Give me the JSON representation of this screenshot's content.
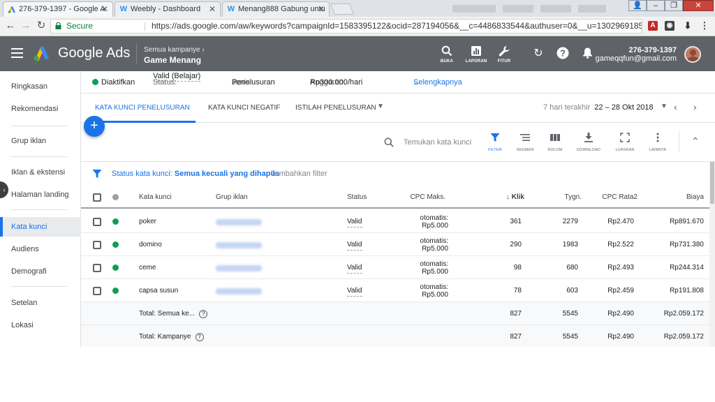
{
  "browser": {
    "tabs": [
      {
        "title": "276-379-1397 - Google A",
        "icon": "google-ads-favicon"
      },
      {
        "title": "Weebly - Dashboard",
        "icon": "weebly-favicon"
      },
      {
        "title": "Menang888 Gabung untu",
        "icon": "weebly-favicon"
      }
    ],
    "secure_label": "Secure",
    "url": "https://ads.google.com/aw/keywords?campaignId=1583395122&ocid=287194056&__c=4486833544&authuser=0&__u=1302969185"
  },
  "header": {
    "brand": "Google Ads",
    "crumb_parent": "Semua kampanye",
    "crumb_current": "Game Menang",
    "icons": [
      {
        "name": "search",
        "label": "BUKA"
      },
      {
        "name": "reports",
        "label": "LAPORAN"
      },
      {
        "name": "tools",
        "label": "FITUR"
      }
    ],
    "account_id": "276-379-1397",
    "account_email": "gameqqfun@gmail.com"
  },
  "sidenav": {
    "items": [
      {
        "label": "Ringkasan"
      },
      {
        "label": "Rekomendasi"
      },
      {
        "label": "Grup iklan"
      },
      {
        "label": "Iklan & ekstensi"
      },
      {
        "label": "Halaman landing"
      },
      {
        "label": "Kata kunci"
      },
      {
        "label": "Audiens"
      },
      {
        "label": "Demografi"
      },
      {
        "label": "Setelan"
      },
      {
        "label": "Lokasi"
      }
    ],
    "active": "Kata kunci"
  },
  "status": {
    "enabled": "Diaktifkan",
    "status_label": "Status:",
    "status_value": "Valid (Belajar)",
    "type_label": "Jenis:",
    "type_value": "Penelusuran",
    "budget_label": "Anggaran:",
    "budget_value": "Rp300.000/hari",
    "more": "Selengkapnya"
  },
  "tabs": {
    "items": [
      "KATA KUNCI PENELUSURAN",
      "KATA KUNCI NEGATIF",
      "ISTILAH PENELUSURAN"
    ],
    "date_label": "7 hari terakhir",
    "date_value": "22 – 28 Okt 2018"
  },
  "toolbar": {
    "search_placeholder": "Temukan kata kunci",
    "buttons": [
      "FILTER",
      "SEGMEN",
      "KOLOM",
      "DOWNLOAD",
      "LUASKAN",
      "LAINNYA"
    ]
  },
  "filter": {
    "prefix": "Status kata kunci:",
    "value": "Semua kecuali yang dihapus",
    "add": "Tambahkan filter"
  },
  "table": {
    "headers": {
      "keyword": "Kata kunci",
      "adgroup": "Grup iklan",
      "status": "Status",
      "cpc_max": "CPC Maks.",
      "clicks": "Klik",
      "impr": "Tygn.",
      "avg_cpc": "CPC Rata2",
      "cost": "Biaya"
    },
    "rows": [
      {
        "keyword": "poker",
        "status": "Valid",
        "cpc_line1": "otomatis:",
        "cpc_line2": "Rp5.000",
        "clicks": "361",
        "impr": "2279",
        "avg_cpc": "Rp2.470",
        "cost": "Rp891.670"
      },
      {
        "keyword": "domino",
        "status": "Valid",
        "cpc_line1": "otomatis:",
        "cpc_line2": "Rp5.000",
        "clicks": "290",
        "impr": "1983",
        "avg_cpc": "Rp2.522",
        "cost": "Rp731.380"
      },
      {
        "keyword": "ceme",
        "status": "Valid",
        "cpc_line1": "otomatis:",
        "cpc_line2": "Rp5.000",
        "clicks": "98",
        "impr": "680",
        "avg_cpc": "Rp2.493",
        "cost": "Rp244.314"
      },
      {
        "keyword": "capsa susun",
        "status": "Valid",
        "cpc_line1": "otomatis:",
        "cpc_line2": "Rp5.000",
        "clicks": "78",
        "impr": "603",
        "avg_cpc": "Rp2.459",
        "cost": "Rp191.808"
      }
    ],
    "totals": [
      {
        "label": "Total: Semua ke...",
        "clicks": "827",
        "impr": "5545",
        "avg_cpc": "Rp2.490",
        "cost": "Rp2.059.172"
      },
      {
        "label": "Total: Kampanye",
        "clicks": "827",
        "impr": "5545",
        "avg_cpc": "Rp2.490",
        "cost": "Rp2.059.172"
      }
    ]
  },
  "colors": {
    "accent": "#1a73e8",
    "header_bg": "#5f6368",
    "enabled_green": "#0f9d58"
  }
}
